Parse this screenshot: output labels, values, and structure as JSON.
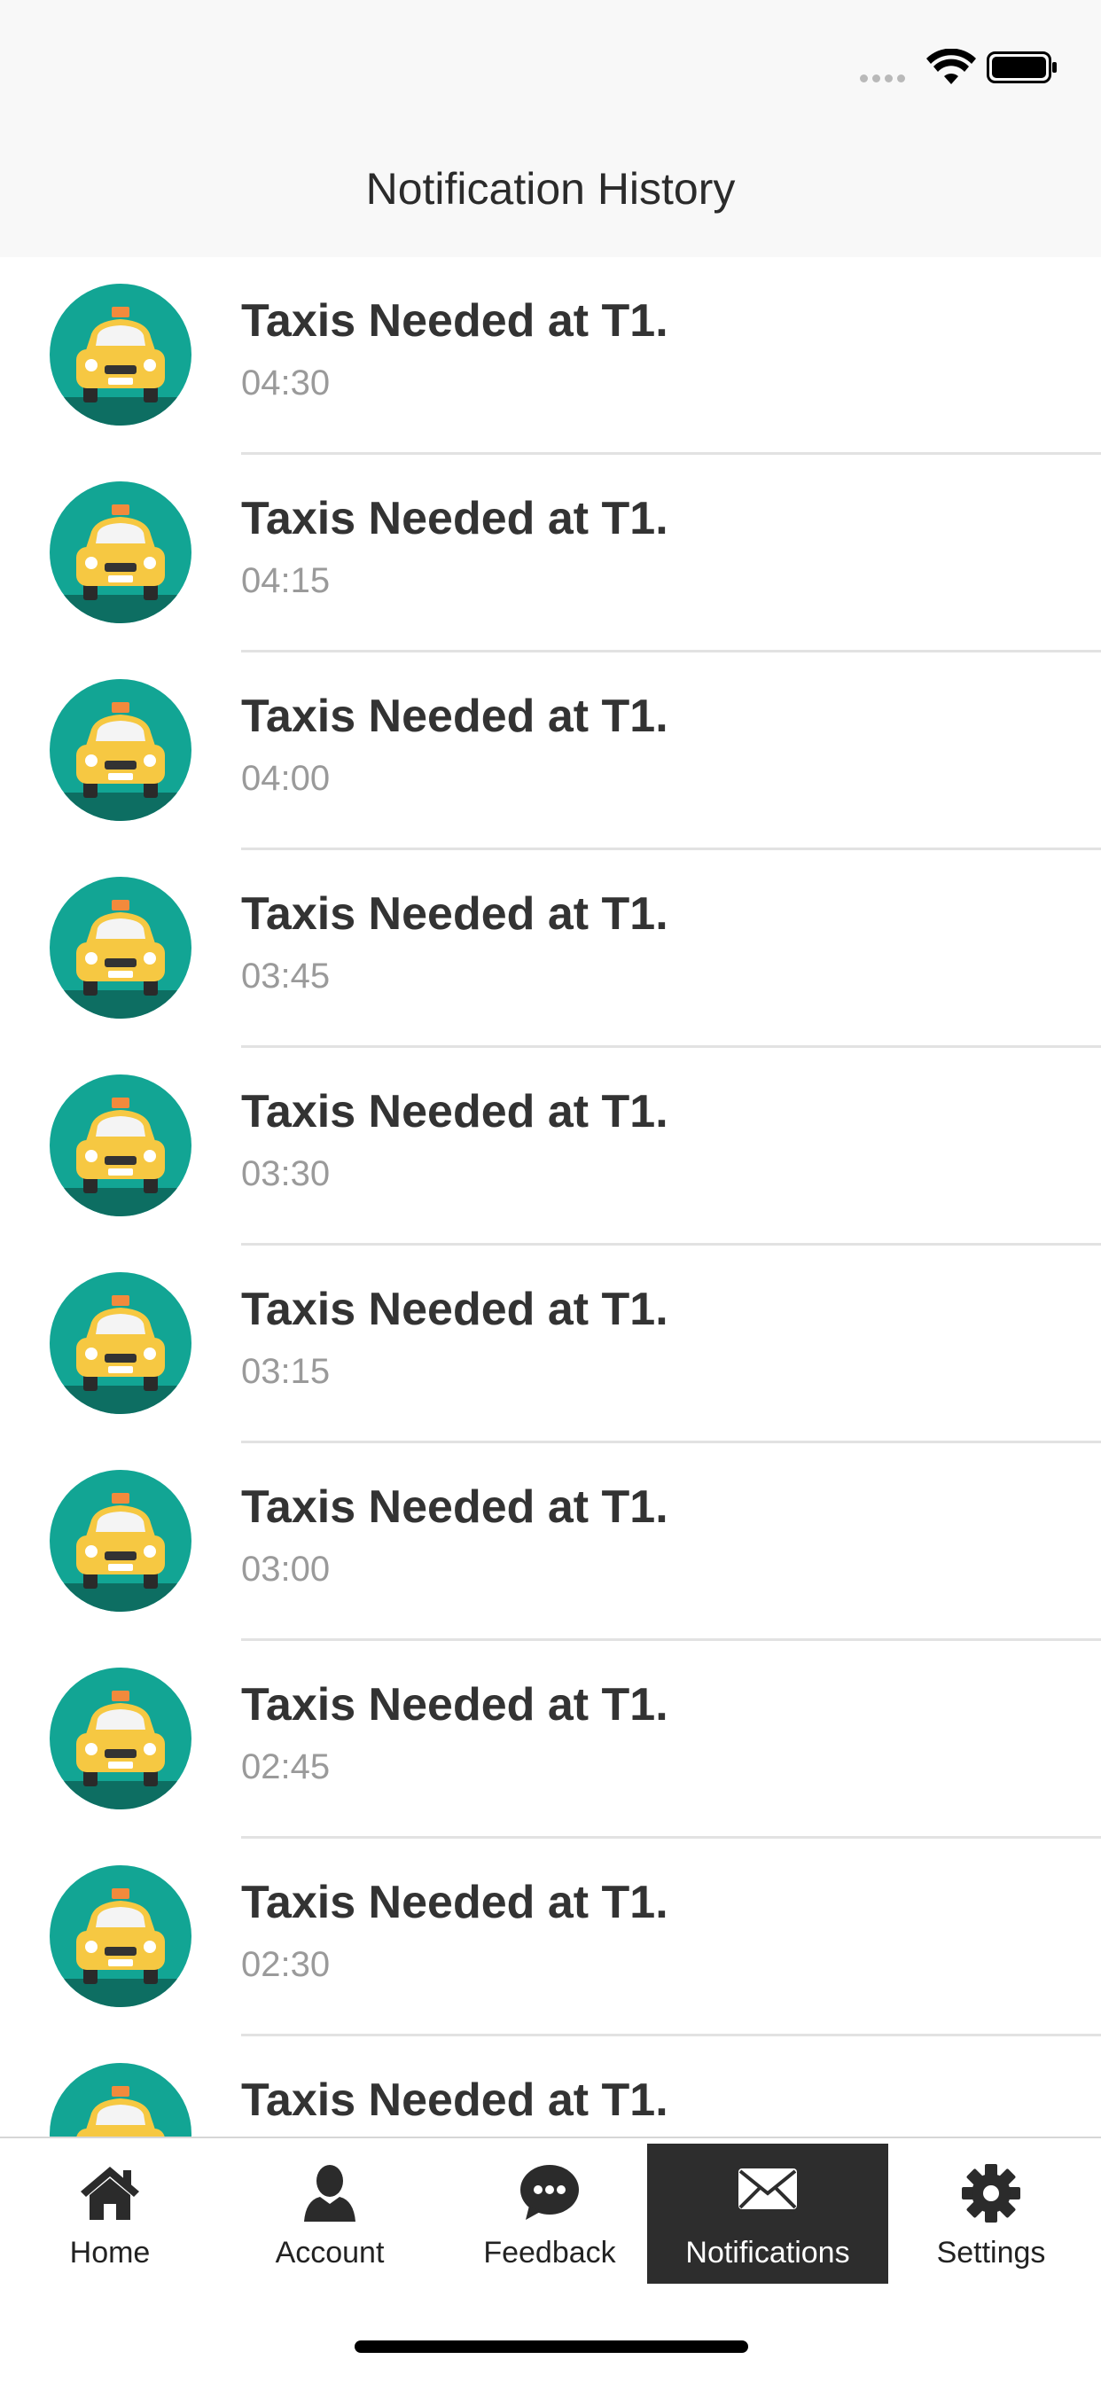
{
  "nav": {
    "title": "Notification History"
  },
  "notifications": [
    {
      "title": "Taxis Needed at T1.",
      "time": "04:30"
    },
    {
      "title": "Taxis Needed at T1.",
      "time": "04:15"
    },
    {
      "title": "Taxis Needed at T1.",
      "time": "04:00"
    },
    {
      "title": "Taxis Needed at T1.",
      "time": "03:45"
    },
    {
      "title": "Taxis Needed at T1.",
      "time": "03:30"
    },
    {
      "title": "Taxis Needed at T1.",
      "time": "03:15"
    },
    {
      "title": "Taxis Needed at T1.",
      "time": "03:00"
    },
    {
      "title": "Taxis Needed at T1.",
      "time": "02:45"
    },
    {
      "title": "Taxis Needed at T1.",
      "time": "02:30"
    },
    {
      "title": "Taxis Needed at T1.",
      "time": ""
    }
  ],
  "tabs": [
    {
      "label": "Home",
      "icon": "home-icon",
      "active": false
    },
    {
      "label": "Account",
      "icon": "account-icon",
      "active": false
    },
    {
      "label": "Feedback",
      "icon": "feedback-icon",
      "active": false
    },
    {
      "label": "Notifications",
      "icon": "envelope-icon",
      "active": true
    },
    {
      "label": "Settings",
      "icon": "gear-icon",
      "active": false
    }
  ],
  "colors": {
    "avatar_bg": "#12a594",
    "avatar_ground": "#0d6e62",
    "taxi_yellow": "#f6c842",
    "active_tab_bg": "#2d2d2d",
    "time_text": "#9a9a9a"
  }
}
